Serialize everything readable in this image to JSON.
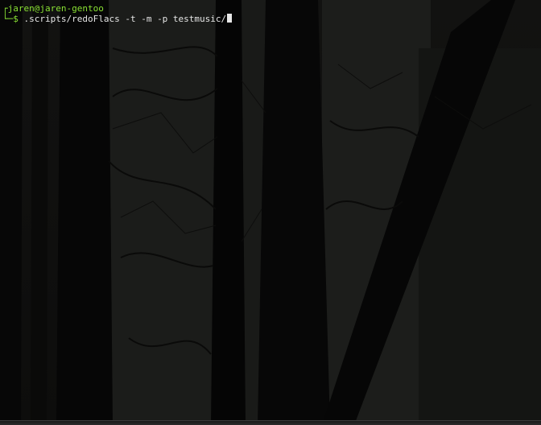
{
  "terminal": {
    "prompt_line1": "┌jaren@jaren-gentoo",
    "prompt_line2_prefix": "└─$ ",
    "command": ".scripts/redoFlacs -t -m -p testmusic/",
    "colors": {
      "prompt": "#8ae234",
      "text": "#e6e6e6",
      "background": "#0b0b0a"
    }
  },
  "wallpaper": {
    "description_icon": "dark-forest-wallpaper"
  }
}
